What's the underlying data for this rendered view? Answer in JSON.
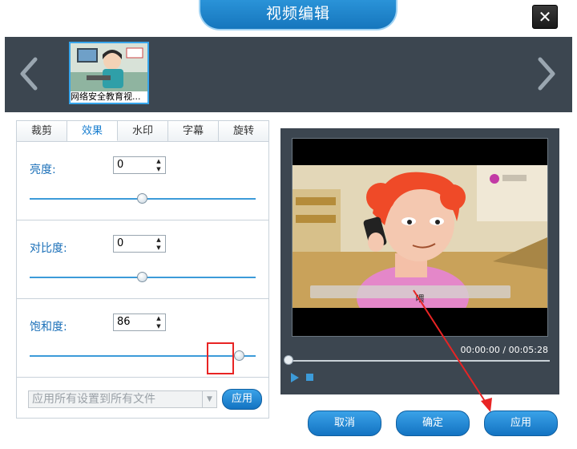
{
  "window": {
    "title": "视频编辑",
    "close_label": "✕"
  },
  "strip": {
    "thumbnail_label": "网络安全教育视..."
  },
  "tabs": [
    {
      "label": "裁剪",
      "active": false
    },
    {
      "label": "效果",
      "active": true
    },
    {
      "label": "水印",
      "active": false
    },
    {
      "label": "字幕",
      "active": false
    },
    {
      "label": "旋转",
      "active": false
    }
  ],
  "brightness": {
    "label": "亮度:",
    "value": "0",
    "level": 0.5
  },
  "contrast": {
    "label": "对比度:",
    "value": "0",
    "level": 0.5
  },
  "saturation": {
    "label": "饱和度:",
    "value": "86",
    "level": 0.93
  },
  "apply_all": {
    "select_value": "应用所有设置到所有文件",
    "apply_label": "应用"
  },
  "preview": {
    "subtitle": "喂",
    "time": "00:00:00 / 00:05:28",
    "progress": 0
  },
  "buttons": {
    "cancel": "取消",
    "ok": "确定",
    "apply": "应用"
  },
  "colors": {
    "accent": "#1a7fd0",
    "panel_dark": "#3c4650",
    "highlight": "#e82424"
  },
  "icons": [
    "close-icon",
    "chevron-left-icon",
    "chevron-right-icon",
    "play-icon",
    "stop-icon",
    "dropdown-icon"
  ]
}
